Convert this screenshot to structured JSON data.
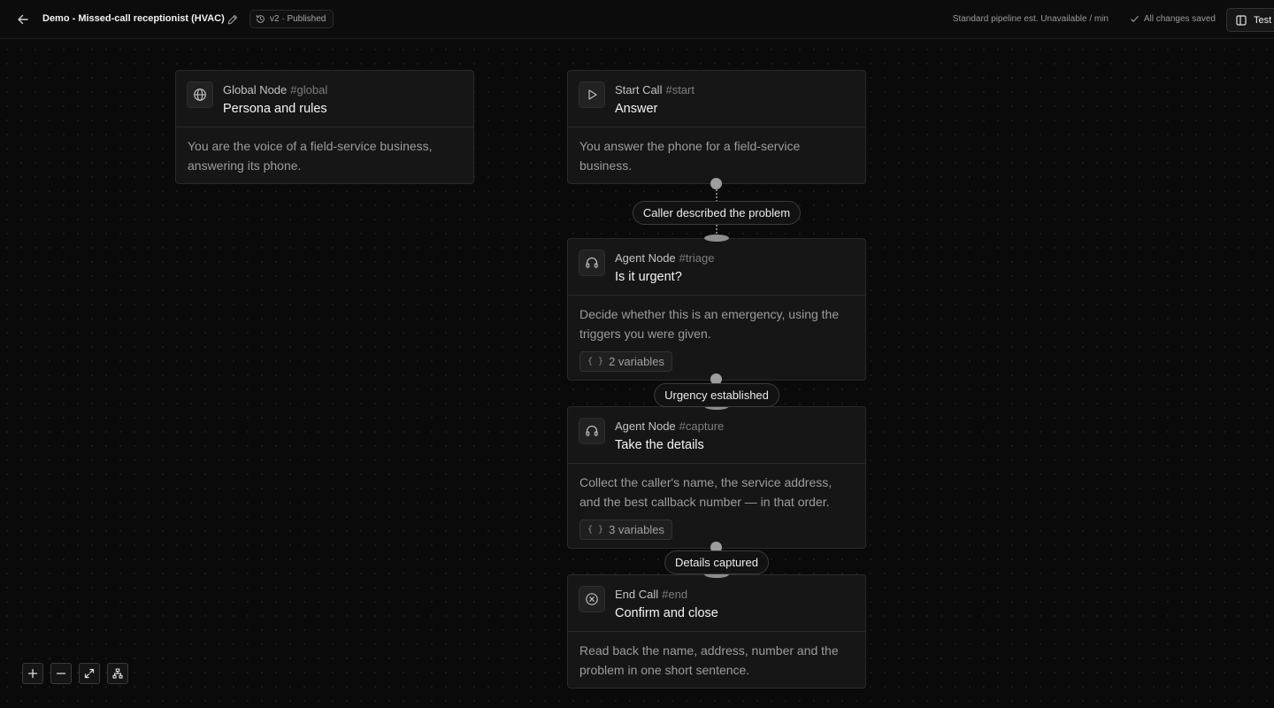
{
  "header": {
    "title": "Demo - Missed-call receptionist (HVAC)",
    "version": "v2 · Published",
    "pipeline_estimate": "Standard pipeline est. Unavailable / min",
    "save_status": "All changes saved",
    "test_label": "Test"
  },
  "nodes": {
    "global": {
      "type": "Global Node",
      "id": "#global",
      "name": "Persona and rules",
      "description": "You are the voice of a field-service business, answering its phone.",
      "icon": "globe-icon"
    },
    "start": {
      "type": "Start Call",
      "id": "#start",
      "name": "Answer",
      "description": "You answer the phone for a field-service business.",
      "icon": "play-icon"
    },
    "triage": {
      "type": "Agent Node",
      "id": "#triage",
      "name": "Is it urgent?",
      "description": "Decide whether this is an emergency, using the triggers you were given.",
      "variables": "2 variables",
      "icon": "headset-icon"
    },
    "capture": {
      "type": "Agent Node",
      "id": "#capture",
      "name": "Take the details",
      "description": "Collect the caller's name, the service address, and the best callback number — in that order.",
      "variables": "3 variables",
      "icon": "headset-icon"
    },
    "end": {
      "type": "End Call",
      "id": "#end",
      "name": "Confirm and close",
      "description": "Read back the name, address, number and the problem in one short sentence.",
      "icon": "x-circle-icon"
    }
  },
  "edges": {
    "start_to_triage": "Caller described the problem",
    "triage_to_capture": "Urgency established",
    "capture_to_end": "Details captured"
  },
  "controls": [
    "zoom-in",
    "zoom-out",
    "fit-view",
    "auto-layout"
  ]
}
